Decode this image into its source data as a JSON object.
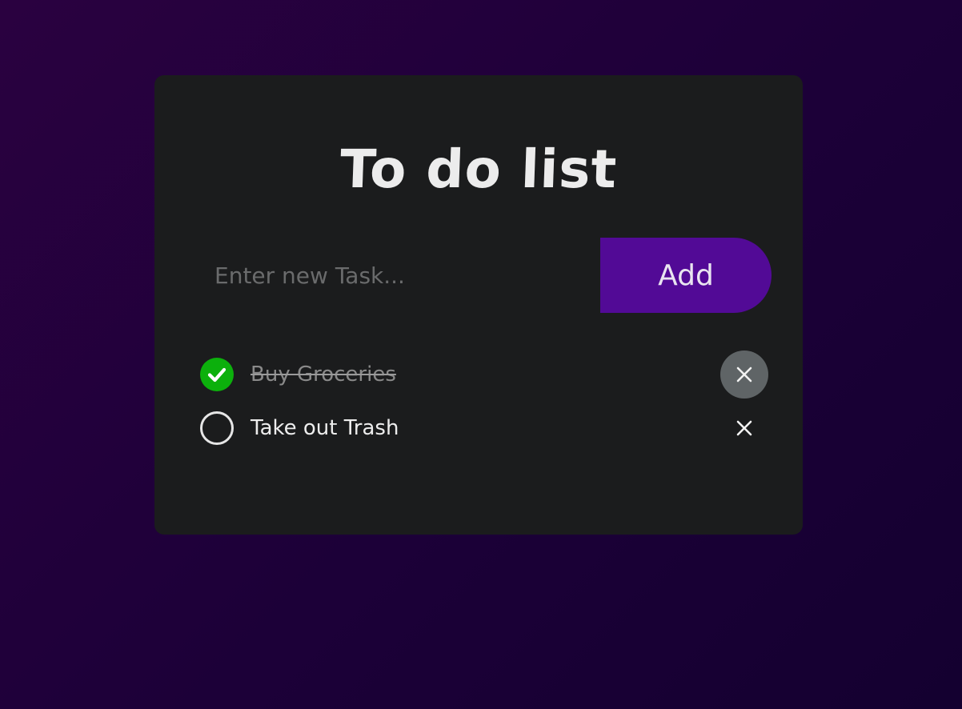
{
  "app": {
    "title": "To do list"
  },
  "new_task": {
    "placeholder": "Enter new Task...",
    "value": "",
    "add_label": "Add"
  },
  "tasks": [
    {
      "label": "Buy Groceries",
      "done": true
    },
    {
      "label": "Take out Trash",
      "done": false
    }
  ],
  "icons": {
    "check": "check-icon",
    "empty": "circle-icon",
    "delete": "close-icon"
  },
  "colors": {
    "accent": "#520a96",
    "done": "#0cb00c",
    "card": "#1b1c1d",
    "delete_hover": "#5f6466"
  }
}
